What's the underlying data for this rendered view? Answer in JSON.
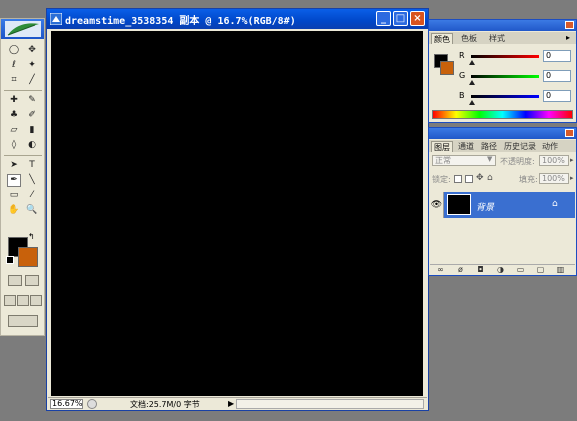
{
  "document": {
    "title": "dreamstime_3538354 副本 @ 16.7%(RGB/8#)",
    "zoom": "16.67%",
    "info": "文档:25.7M/0 字节",
    "window_buttons": {
      "minimize": "_",
      "maximize": "□",
      "close": "×"
    }
  },
  "toolbox": {
    "foreground_color": "#000000",
    "background_color": "#c8610b",
    "tools": [
      "marquee",
      "move",
      "lasso",
      "magic-wand",
      "crop",
      "slice",
      "healing-brush",
      "brush",
      "clone-stamp",
      "history-brush",
      "eraser",
      "gradient",
      "blur",
      "dodge",
      "path-selection",
      "type",
      "pen",
      "line",
      "notes",
      "eyedropper",
      "hand",
      "zoom"
    ],
    "glyphs": {
      "type": "T",
      "zoom": "🔍",
      "hand": "✋"
    }
  },
  "color_panel": {
    "tabs": [
      "颜色",
      "色板",
      "样式"
    ],
    "active_tab": "颜色",
    "channels": [
      {
        "label": "R",
        "value": "0",
        "color": "#cc0000"
      },
      {
        "label": "G",
        "value": "0",
        "color": "#00a000"
      },
      {
        "label": "B",
        "value": "0",
        "color": "#0000cc"
      }
    ]
  },
  "layers_panel": {
    "tabs": [
      "图层",
      "通道",
      "路径",
      "历史记录",
      "动作"
    ],
    "active_tab": "图层",
    "blend_mode": "正常",
    "opacity_label": "不透明度:",
    "opacity_value": "100%",
    "lock_label": "锁定:",
    "fill_label": "填充:",
    "fill_value": "100%",
    "layers": [
      {
        "name": "背景",
        "visible": true,
        "locked": true,
        "selected": true
      }
    ]
  }
}
